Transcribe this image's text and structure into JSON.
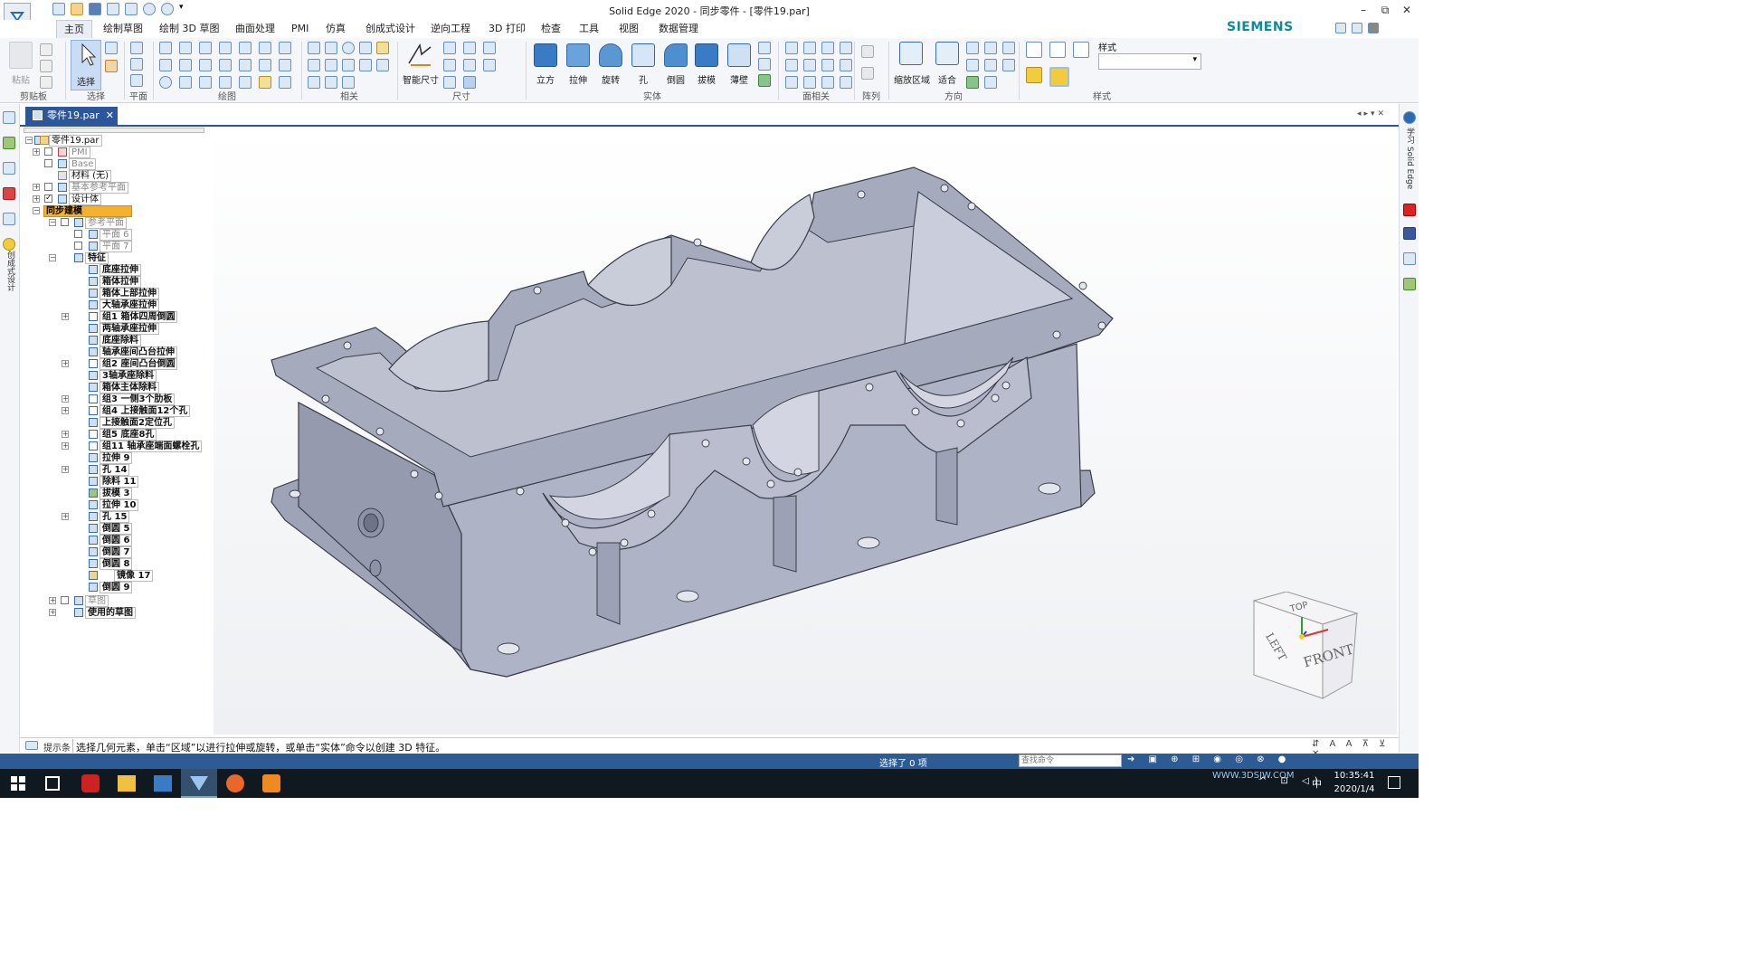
{
  "window": {
    "title": "Solid Edge 2020 - 同步零件 - [零件19.par]",
    "brand": "SIEMENS",
    "controls": [
      "–",
      "⧉",
      "✕"
    ]
  },
  "menu": {
    "tabs": [
      "主页",
      "绘制草图",
      "绘制 3D 草图",
      "曲面处理",
      "PMI",
      "仿真",
      "创成式设计",
      "逆向工程",
      "3D 打印",
      "检查",
      "工具",
      "视图",
      "数据管理"
    ],
    "active": "主页"
  },
  "ribbon": {
    "groups": [
      "剪贴板",
      "选择",
      "平面",
      "绘图",
      "相关",
      "尺寸",
      "实体",
      "面相关",
      "阵列",
      "方向",
      "样式"
    ],
    "paste": "粘贴",
    "select": "选择",
    "smart_dim": "智能尺寸",
    "solids": [
      "立方",
      "拉伸",
      "旋转",
      "孔",
      "倒圆",
      "拔模",
      "薄壁"
    ],
    "zoom_area": "缩放区域",
    "fit": "适合",
    "style_label": "样式"
  },
  "document_tab": "零件19.par",
  "tree": {
    "root": "零件19.par",
    "pmi": "PMI",
    "base": "Base",
    "material": "材料 (无)",
    "base_ref_planes": "基本参考平面",
    "design_body": "设计体",
    "sync_modeling": "同步建模",
    "ref_planes": "参考平面",
    "plane6": "平面 6",
    "plane7": "平面 7",
    "features": "特征",
    "feature_items": [
      "底座拉伸",
      "箱体拉伸",
      "箱体上部拉伸",
      "大轴承座拉伸",
      "组1 箱体四周倒圆",
      "两轴承座拉伸",
      "底座除料",
      "轴承座间凸台拉伸",
      "组2 座间凸台倒圆",
      "3轴承座除料",
      "箱体主体除料",
      "组3 一侧3个肋板",
      "组4 上接触面12个孔",
      "上接触面2定位孔",
      "组5 底座8孔",
      "组11 轴承座端面螺栓孔",
      "拉伸 9",
      "孔 14",
      "除料 11",
      "拔模 3",
      "拉伸 10",
      "孔 15",
      "倒圆 5",
      "倒圆 6",
      "倒圆 7",
      "倒圆 8",
      "镜像 17",
      "倒圆 9"
    ],
    "sketches": "草图",
    "used_sketches": "使用的草图"
  },
  "left_strip": {
    "vertical_label": "创成式设计"
  },
  "right_strip": {
    "vertical_label": "学习 Solid Edge"
  },
  "viewcube": {
    "top": "TOP",
    "left": "LEFT",
    "front": "FRONT"
  },
  "prompt": {
    "label": "提示条",
    "text": "选择几何元素，单击“区域”以进行拉伸或旋转，或单击“实体”命令以创建 3D 特征。"
  },
  "status": {
    "selection": "选择了 0 项",
    "search_placeholder": "查找命令"
  },
  "taskbar": {
    "time": "10:35:41",
    "date": "2020/1/4",
    "ime": "中",
    "watermark": "WWW.3DSJW.COM"
  },
  "colors": {
    "accent": "#2b579a",
    "highlight": "#f5b02e",
    "model_face": "#a9aec1",
    "model_dark": "#8f94a8",
    "model_light": "#c4c8d6"
  }
}
